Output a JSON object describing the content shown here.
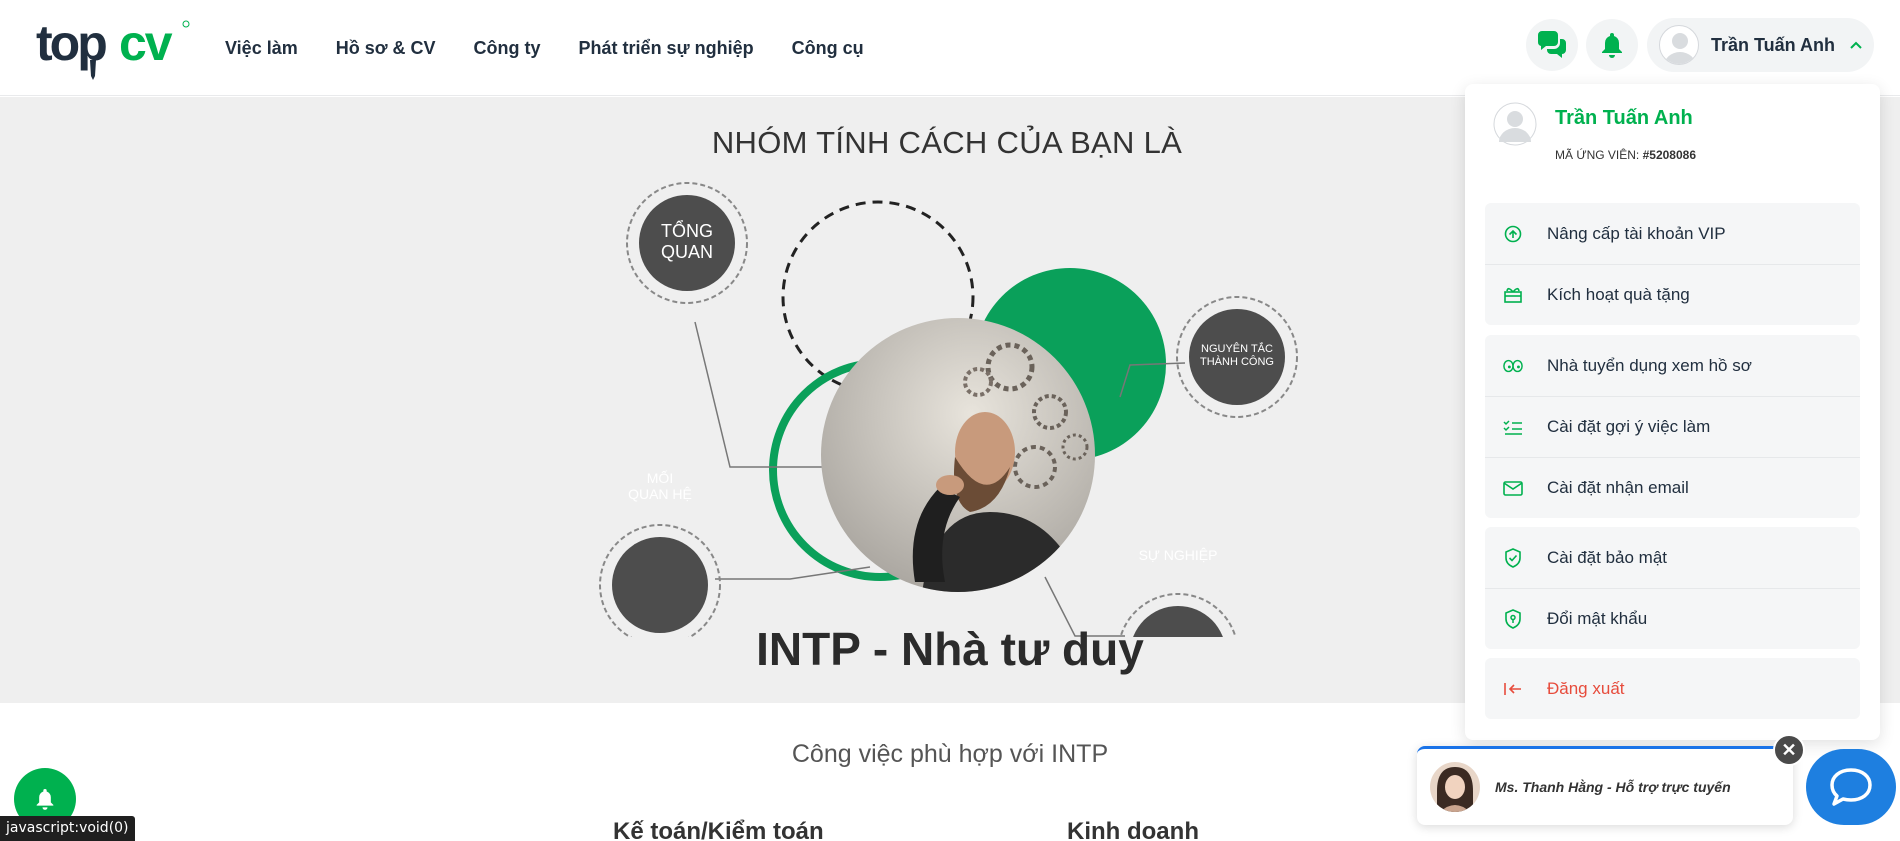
{
  "header": {
    "logo_text": "topcv",
    "nav": [
      "Việc làm",
      "Hồ sơ & CV",
      "Công ty",
      "Phát triển sự nghiệp",
      "Công cụ"
    ],
    "user_name": "Trần Tuấn Anh"
  },
  "hero": {
    "title": "NHÓM TÍNH CÁCH CỦA BẠN LÀ",
    "bubbles": {
      "overview": "TỔNG QUAN",
      "principles": "NGUYÊN TẮC THÀNH CÔNG",
      "relations": "MỐI QUAN HỆ",
      "career": "SỰ NGHIỆP"
    },
    "type": "INTP - Nhà tư duy"
  },
  "jobs": {
    "title": "Công việc phù hợp với INTP",
    "categories": [
      "Kế toán/Kiểm toán",
      "Kinh doanh"
    ]
  },
  "dropdown": {
    "name": "Trần Tuấn Anh",
    "code_label": "MÃ ỨNG VIÊN:",
    "code_value": "#5208086",
    "groups": [
      [
        {
          "icon": "upgrade-icon",
          "label": "Nâng cấp tài khoản VIP"
        },
        {
          "icon": "gift-icon",
          "label": "Kích hoạt quà tặng"
        }
      ],
      [
        {
          "icon": "eyes-icon",
          "label": "Nhà tuyển dụng xem hồ sơ"
        },
        {
          "icon": "checklist-icon",
          "label": "Cài đặt gợi ý việc làm"
        },
        {
          "icon": "mail-icon",
          "label": "Cài đặt nhận email"
        }
      ],
      [
        {
          "icon": "shield-check-icon",
          "label": "Cài đặt bảo mật"
        },
        {
          "icon": "shield-key-icon",
          "label": "Đổi mật khẩu"
        }
      ],
      [
        {
          "icon": "logout-icon",
          "label": "Đăng xuất"
        }
      ]
    ]
  },
  "support": {
    "text": "Ms. Thanh Hằng - Hỗ trợ trực tuyến",
    "close": "✕"
  },
  "status_bar": "javascript:void(0)",
  "colors": {
    "brand_green": "#00b14f",
    "hero_bg": "#efefef",
    "logout_red": "#e74c3c",
    "chat_blue": "#1e7fe0"
  }
}
